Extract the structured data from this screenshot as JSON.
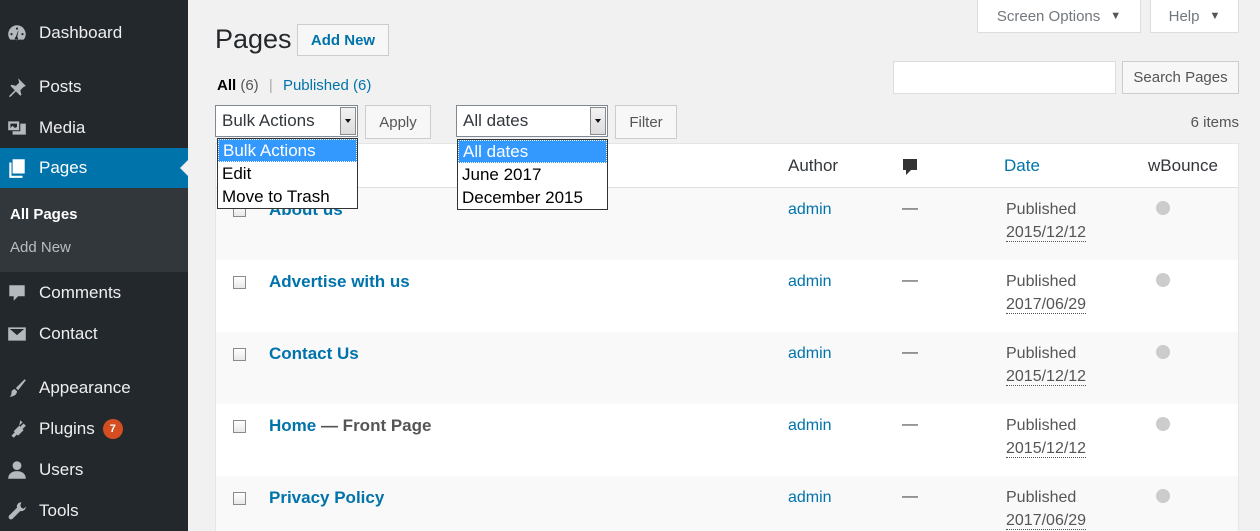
{
  "sidebar": {
    "items": [
      {
        "label": "Dashboard",
        "icon": "dashboard-icon"
      },
      {
        "label": "Posts",
        "icon": "pin-icon"
      },
      {
        "label": "Media",
        "icon": "media-icon"
      },
      {
        "label": "Pages",
        "icon": "pages-icon"
      },
      {
        "label": "Comments",
        "icon": "comment-icon"
      },
      {
        "label": "Contact",
        "icon": "mail-icon"
      },
      {
        "label": "Appearance",
        "icon": "paintbrush-icon"
      },
      {
        "label": "Plugins",
        "icon": "plugin-icon",
        "badge": "7"
      },
      {
        "label": "Users",
        "icon": "users-icon"
      },
      {
        "label": "Tools",
        "icon": "wrench-icon"
      }
    ],
    "submenu": [
      {
        "label": "All Pages"
      },
      {
        "label": "Add New"
      }
    ],
    "badge_color": "#d54e21",
    "active_color": "#0073aa"
  },
  "screen_meta": {
    "screen_options": "Screen Options",
    "help": "Help"
  },
  "header": {
    "title": "Pages",
    "add_new": "Add New"
  },
  "views": {
    "all_label": "All",
    "all_count": "(6)",
    "separator": "|",
    "published_label": "Published",
    "published_count": "(6)"
  },
  "search": {
    "value": "",
    "button": "Search Pages"
  },
  "tablenav": {
    "bulk_selected": "Bulk Actions",
    "bulk_options": [
      "Bulk Actions",
      "Edit",
      "Move to Trash"
    ],
    "apply": "Apply",
    "date_selected": "All dates",
    "date_options": [
      "All dates",
      "June 2017",
      "December 2015"
    ],
    "filter": "Filter",
    "items_count": "6 items"
  },
  "table": {
    "headers": {
      "author": "Author",
      "comments_icon": "comment-bubble-icon",
      "date": "Date",
      "wbounce": "wBounce"
    },
    "rows": [
      {
        "title": "About us",
        "state": "",
        "author": "admin",
        "comments": "—",
        "status": "Published",
        "date": "2015/12/12"
      },
      {
        "title": "Advertise with us",
        "state": "",
        "author": "admin",
        "comments": "—",
        "status": "Published",
        "date": "2017/06/29"
      },
      {
        "title": "Contact Us",
        "state": "",
        "author": "admin",
        "comments": "—",
        "status": "Published",
        "date": "2015/12/12"
      },
      {
        "title": "Home",
        "state": " — Front Page",
        "author": "admin",
        "comments": "—",
        "status": "Published",
        "date": "2015/12/12"
      },
      {
        "title": "Privacy Policy",
        "state": "",
        "author": "admin",
        "comments": "—",
        "status": "Published",
        "date": "2017/06/29"
      }
    ]
  }
}
